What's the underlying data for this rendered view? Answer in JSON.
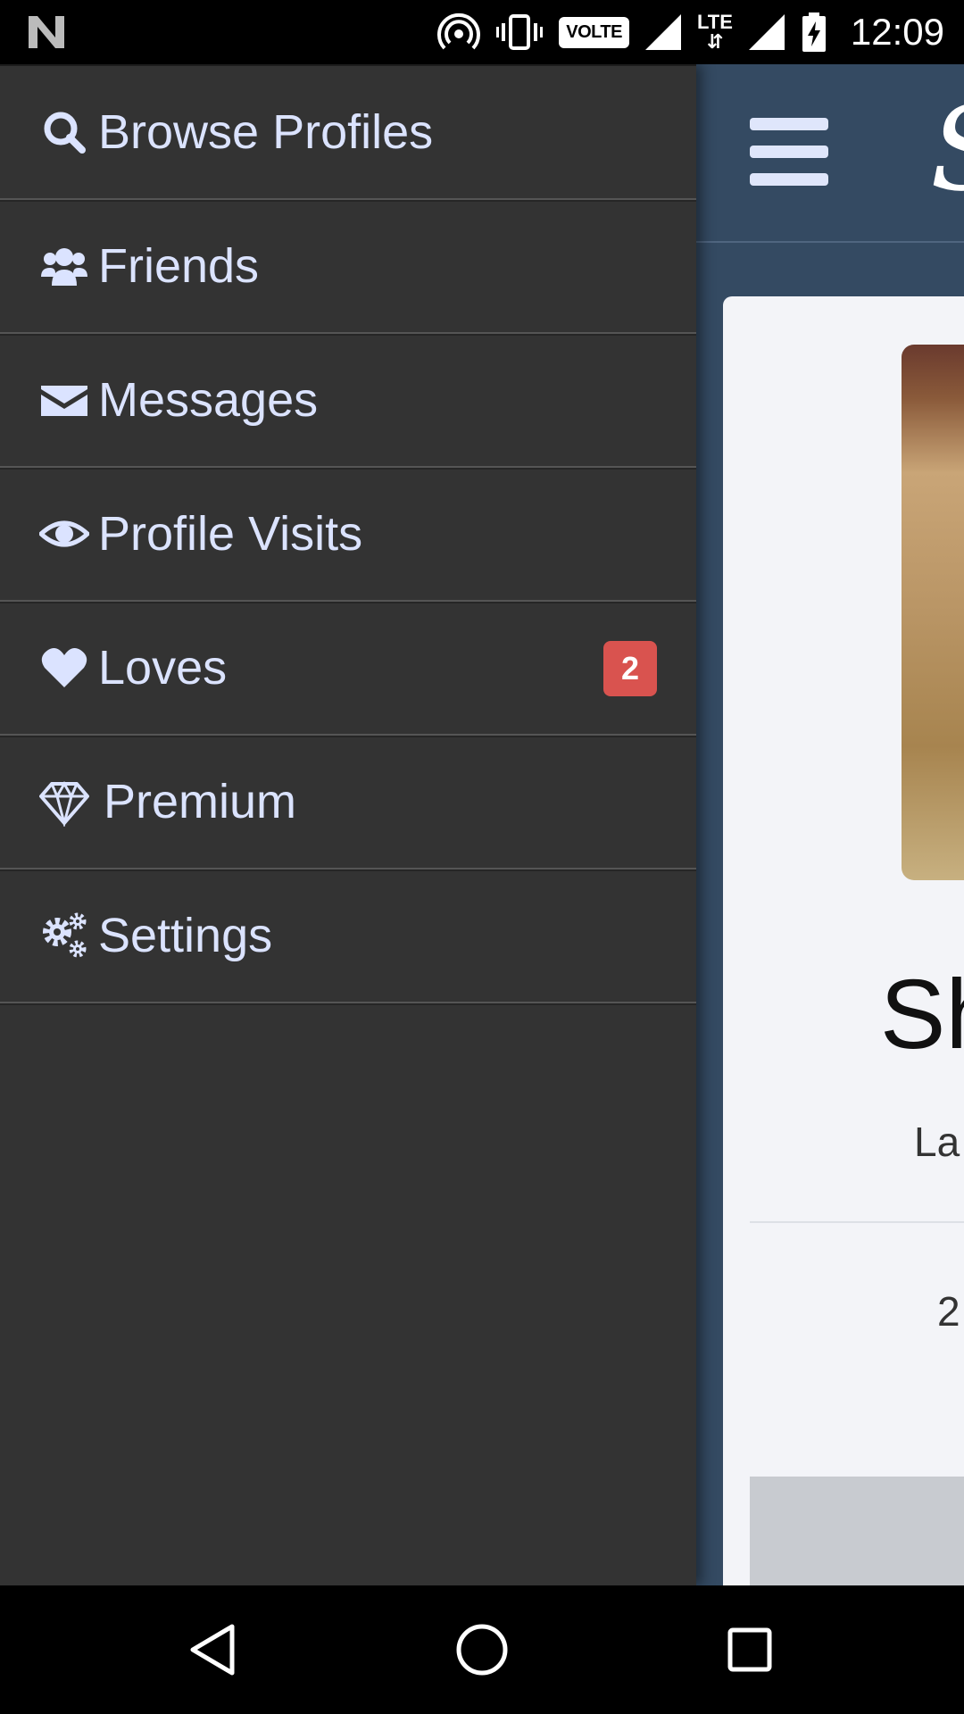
{
  "status_bar": {
    "time": "12:09",
    "volte": "VOLTE",
    "lte": "LTE",
    "icons": [
      "n-logo-icon",
      "hotspot-icon",
      "vibrate-icon",
      "volte-icon",
      "signal-icon",
      "lte-icon",
      "signal-icon",
      "battery-charging-icon"
    ]
  },
  "drawer": {
    "items": [
      {
        "label": "Browse Profiles",
        "icon": "search-icon"
      },
      {
        "label": "Friends",
        "icon": "users-icon"
      },
      {
        "label": "Messages",
        "icon": "envelope-icon"
      },
      {
        "label": "Profile Visits",
        "icon": "eye-icon"
      },
      {
        "label": "Loves",
        "icon": "heart-icon",
        "badge": "2"
      },
      {
        "label": "Premium",
        "icon": "diamond-icon"
      },
      {
        "label": "Settings",
        "icon": "gears-icon"
      }
    ]
  },
  "app": {
    "logo_partial": "S",
    "profile_name_partial": "Sh",
    "profile_sub_partial": "La",
    "profile_num_partial": "2"
  },
  "colors": {
    "drawer_bg": "#333333",
    "drawer_text": "#dbe3ff",
    "app_bg": "#344a62",
    "badge": "#d9534f"
  },
  "nav_bar": {
    "icons": [
      "back-icon",
      "home-icon",
      "recents-icon"
    ]
  }
}
